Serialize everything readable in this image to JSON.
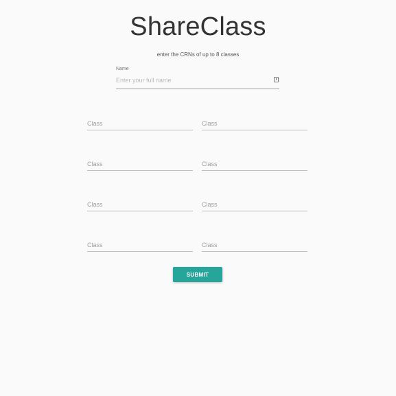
{
  "header": {
    "title": "ShareClass",
    "subtitle": "enter the CRNs of up to 8 classes"
  },
  "name_field": {
    "label": "Name",
    "placeholder": "Enter your full name",
    "value": "",
    "icon": "id-card-icon"
  },
  "class_fields": [
    {
      "placeholder": "Class",
      "value": ""
    },
    {
      "placeholder": "Class",
      "value": ""
    },
    {
      "placeholder": "Class",
      "value": ""
    },
    {
      "placeholder": "Class",
      "value": ""
    },
    {
      "placeholder": "Class",
      "value": ""
    },
    {
      "placeholder": "Class",
      "value": ""
    },
    {
      "placeholder": "Class",
      "value": ""
    },
    {
      "placeholder": "Class",
      "value": ""
    }
  ],
  "actions": {
    "submit_label": "SUBMIT"
  },
  "colors": {
    "background": "#fafafa",
    "accent": "#26a69a",
    "underline": "#bdbdbd"
  }
}
